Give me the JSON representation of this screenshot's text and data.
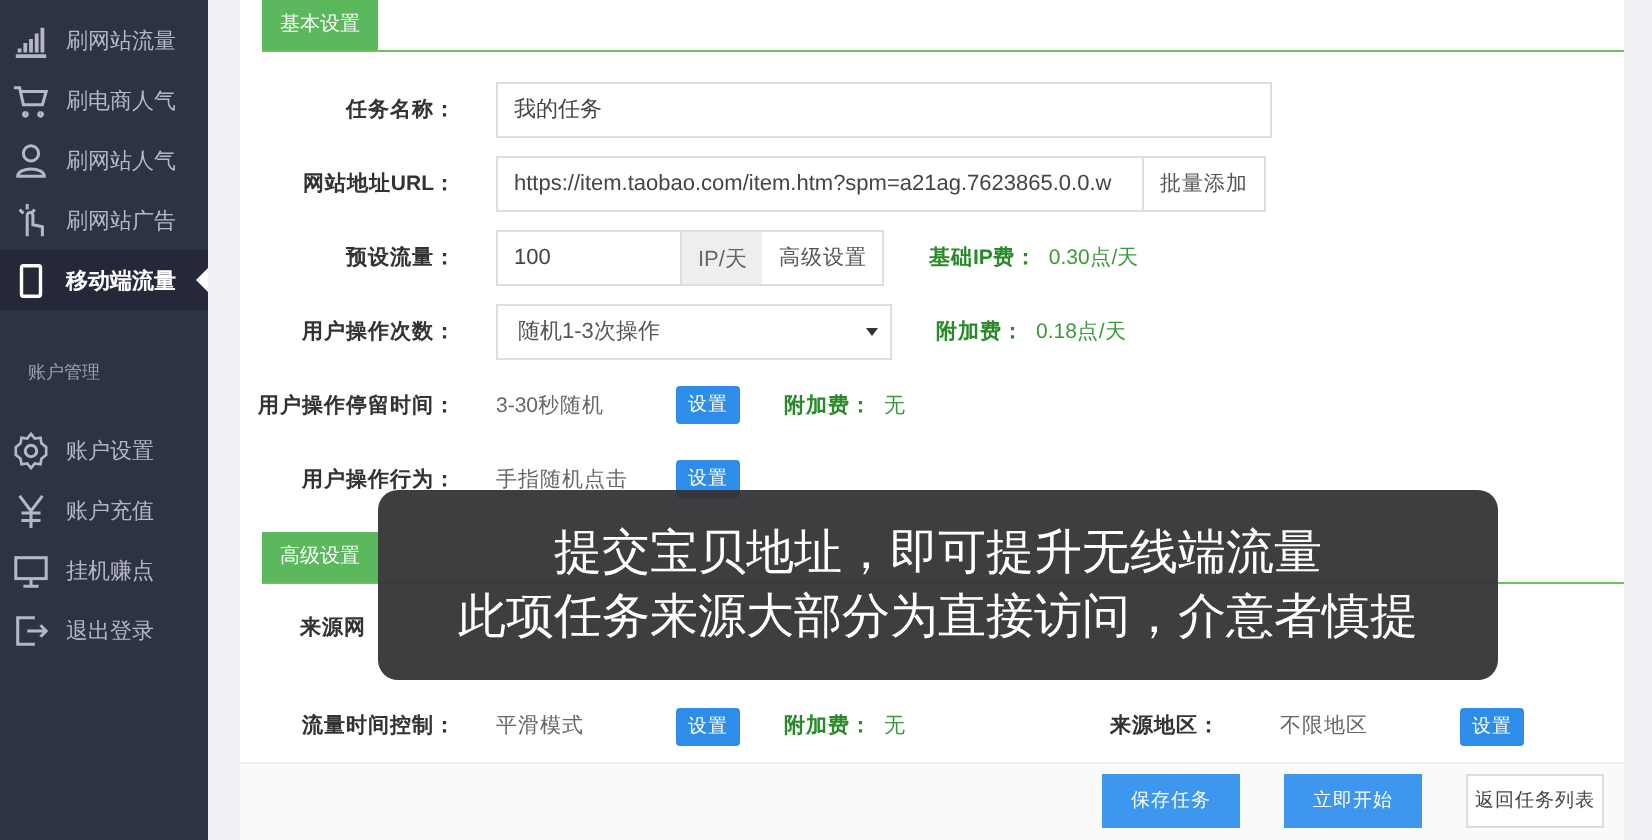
{
  "sidebar": {
    "items": [
      {
        "label": "刷网站流量",
        "selected": false
      },
      {
        "label": "刷电商人气",
        "selected": false
      },
      {
        "label": "刷网站人气",
        "selected": false
      },
      {
        "label": "刷网站广告",
        "selected": false
      },
      {
        "label": "移动端流量",
        "selected": true
      }
    ],
    "section_title": "账户管理",
    "account_items": [
      {
        "label": "账户设置"
      },
      {
        "label": "账户充值"
      },
      {
        "label": "挂机赚点"
      },
      {
        "label": "退出登录"
      }
    ]
  },
  "basic_settings": {
    "title": "基本设置",
    "rows": [
      {
        "kind": "input",
        "label": "任务名称：",
        "value": "我的任务"
      },
      {
        "kind": "input_button",
        "label": "网站地址URL：",
        "value": "https://item.taobao.com/item.htm?spm=a21ag.7623865.0.0.w",
        "button": "批量添加"
      },
      {
        "kind": "input_addon",
        "label": "预设流量：",
        "value": "100",
        "addon": "IP/天",
        "button": "高级设置",
        "fee_label": "基础IP费：",
        "fee": "0.30点/天"
      },
      {
        "kind": "select",
        "label": "用户操作次数：",
        "value": "随机1-3次操作",
        "fee_label": "附加费：",
        "fee": "0.18点/天"
      },
      {
        "kind": "text_button",
        "label": "用户操作停留时间：",
        "value": "3-30秒随机",
        "button": "设置",
        "fee_label": "附加费：",
        "fee": "无"
      },
      {
        "kind": "text_button",
        "label": "用户操作行为：",
        "value": "手指随机点击",
        "button": "设置"
      }
    ]
  },
  "advanced_settings": {
    "title": "高级设置",
    "row_label": "来源网",
    "time_control": {
      "label": "流量时间控制：",
      "value": "平滑模式",
      "button": "设置",
      "fee_label": "附加费：",
      "fee": "无"
    },
    "region": {
      "label": "来源地区：",
      "value": "不限地区",
      "button": "设置"
    }
  },
  "footer_buttons": [
    {
      "label": "保存任务",
      "kind": "primary"
    },
    {
      "label": "立即开始",
      "kind": "primary"
    },
    {
      "label": "返回任务列表",
      "kind": "default"
    }
  ],
  "caption": [
    "提交宝贝地址，即可提升无线端流量",
    "此项任务来源大部分为直接访问，介意者慎提"
  ]
}
